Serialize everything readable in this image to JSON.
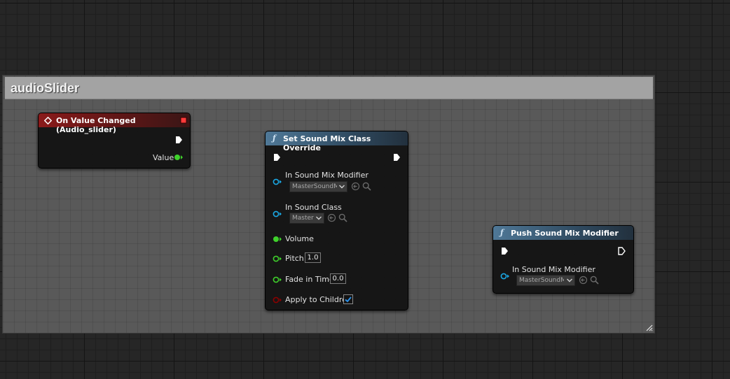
{
  "comment": {
    "title": "audioSlider"
  },
  "event_node": {
    "title": "On Value Changed (Audio_slider)",
    "value_pin": "Value"
  },
  "set_node": {
    "title": "Set Sound Mix Class Override",
    "pins": {
      "in_sound_mix_modifier": {
        "label": "In Sound Mix Modifier",
        "value": "MasterSoundM"
      },
      "in_sound_class": {
        "label": "In Sound Class",
        "value": "Master"
      },
      "volume": {
        "label": "Volume"
      },
      "pitch": {
        "label": "Pitch",
        "value": "1.0"
      },
      "fade_in_time": {
        "label": "Fade in Time",
        "value": "0.0"
      },
      "apply_to_children": {
        "label": "Apply to Children",
        "checked": true
      }
    }
  },
  "push_node": {
    "title": "Push Sound Mix Modifier",
    "pins": {
      "in_sound_mix_modifier": {
        "label": "In Sound Mix Modifier",
        "value": "MasterSoundM"
      }
    }
  },
  "icons": {
    "function": "function-f-icon",
    "event": "event-diamond-icon",
    "exec": "exec-arrow-icon",
    "object_pin": "object-pin-icon",
    "float_pin": "float-pin-icon",
    "bool_pin": "bool-pin-icon",
    "use_selected": "use-selected-arrow-icon",
    "browse": "browse-search-icon",
    "dropdown": "chevron-down-icon",
    "delegate": "delegate-square-icon"
  },
  "colors": {
    "event_header": "#8a1a1a",
    "function_header": "#4f7897",
    "exec_wire": "#ffffff",
    "float_pin": "#3fd12b",
    "object_pin": "#1aa9e6",
    "bool_pin": "#8c0000",
    "delegate_pin": "#ff4040"
  }
}
